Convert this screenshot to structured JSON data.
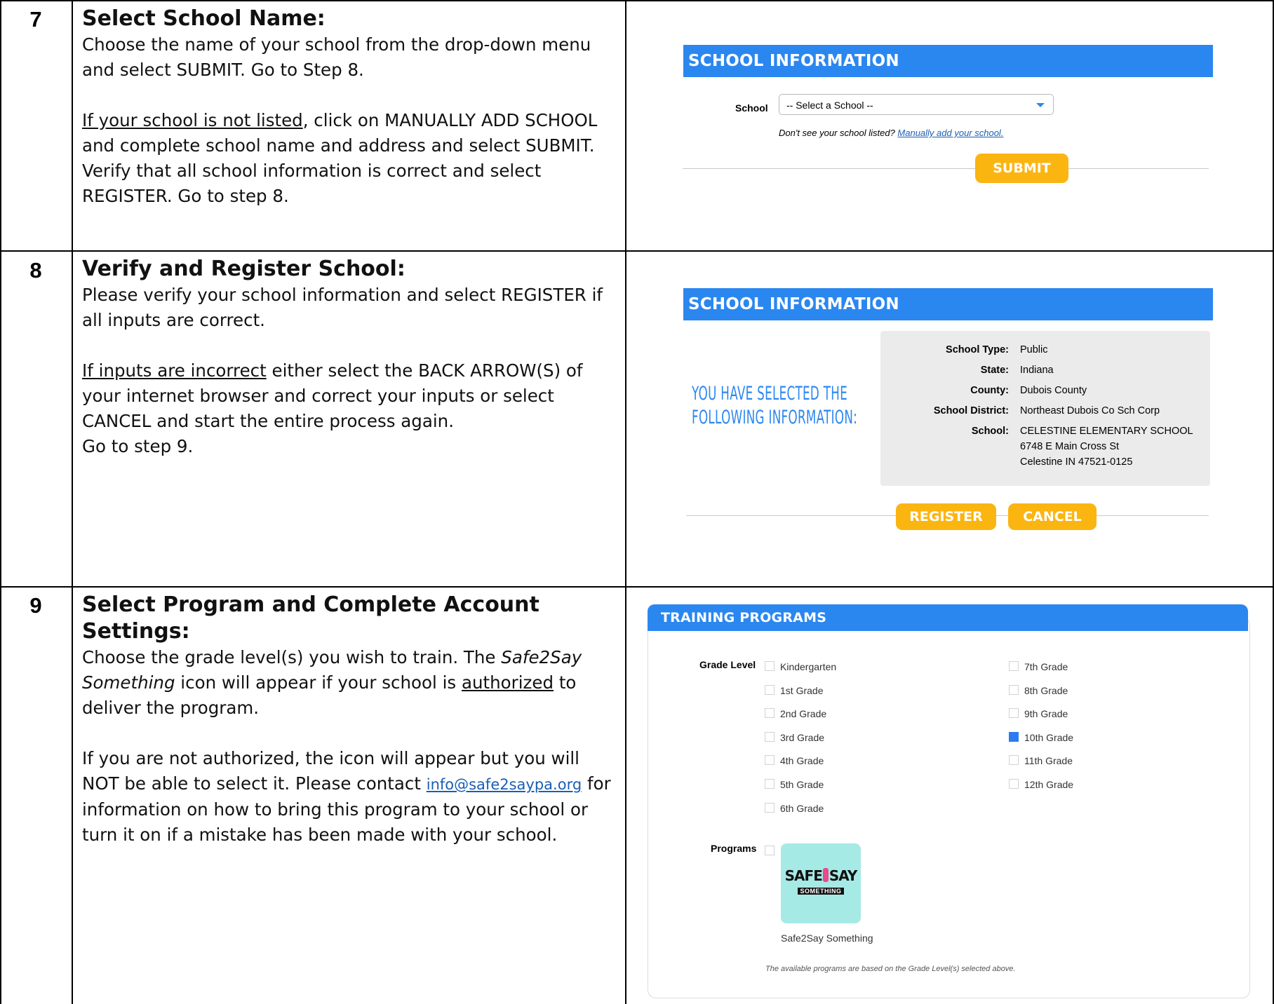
{
  "steps": [
    {
      "number": "7",
      "title": "Select School Name:",
      "p1": "Choose the name of your school from the drop-down menu and select SUBMIT. Go to Step 8.",
      "p2_underline": "If your school is not listed",
      "p2_rest": ", click on MANUALLY ADD SCHOOL and complete school name and address and select SUBMIT. Verify that all school information is correct and select REGISTER. Go to step 8."
    },
    {
      "number": "8",
      "title": "Verify and Register School:",
      "p1": "Please verify your school information and select REGISTER if all inputs are correct.",
      "p2_underline": "If inputs are incorrect",
      "p2_rest": " either select the BACK ARROW(S) of your internet browser and correct your inputs or select CANCEL and start the entire process again.",
      "p3": "Go to step 9."
    },
    {
      "number": "9",
      "title": "Select Program and Complete Account Settings:",
      "p1_a": "Choose the grade level(s) you wish to train. The ",
      "p1_italic": "Safe2Say Something",
      "p1_b": " icon will appear if your school is ",
      "p1_underline": "authorized",
      "p1_c": " to deliver the program.",
      "p2_a": "If you are not authorized, the icon will appear but you will NOT be able to select it. Please contact ",
      "p2_link": "info@safe2saypa.org",
      "p2_b": " for information on how to bring this program to your school or turn it on if a mistake has been made with your school."
    }
  ],
  "shot7": {
    "header": "SCHOOL INFORMATION",
    "school_label": "School",
    "select_value": "-- Select a School --",
    "hint_text": "Don't see your school listed? ",
    "hint_link": "Manually add your school.",
    "submit_label": "SUBMIT"
  },
  "shot8": {
    "header": "SCHOOL INFORMATION",
    "selected_line1": "YOU HAVE SELECTED THE",
    "selected_line2": "FOLLOWING INFORMATION:",
    "fields": [
      {
        "label": "School Type:",
        "value": "Public"
      },
      {
        "label": "State:",
        "value": "Indiana"
      },
      {
        "label": "County:",
        "value": "Dubois County"
      },
      {
        "label": "School District:",
        "value": "Northeast Dubois Co Sch Corp"
      },
      {
        "label": "School:",
        "value": "CELESTINE ELEMENTARY SCHOOL"
      }
    ],
    "address_line1": "6748 E Main Cross St",
    "address_line2": "Celestine IN 47521-0125",
    "register_label": "REGISTER",
    "cancel_label": "CANCEL"
  },
  "shot9": {
    "header": "TRAINING PROGRAMS",
    "grade_level_label": "Grade Level",
    "grades_left": [
      "Kindergarten",
      "1st Grade",
      "2nd Grade",
      "3rd Grade",
      "4th Grade",
      "5th Grade",
      "6th Grade"
    ],
    "grades_right": [
      "7th Grade",
      "8th Grade",
      "9th Grade",
      "10th Grade",
      "11th Grade",
      "12th Grade"
    ],
    "checked_grade": "10th Grade",
    "programs_label": "Programs",
    "logo_text_left": "SAFE",
    "logo_text_right": "SAY",
    "logo_sub": "SOMETHING",
    "program_name": "Safe2Say Something",
    "footnote": "The available programs are based on the Grade Level(s) selected above."
  }
}
